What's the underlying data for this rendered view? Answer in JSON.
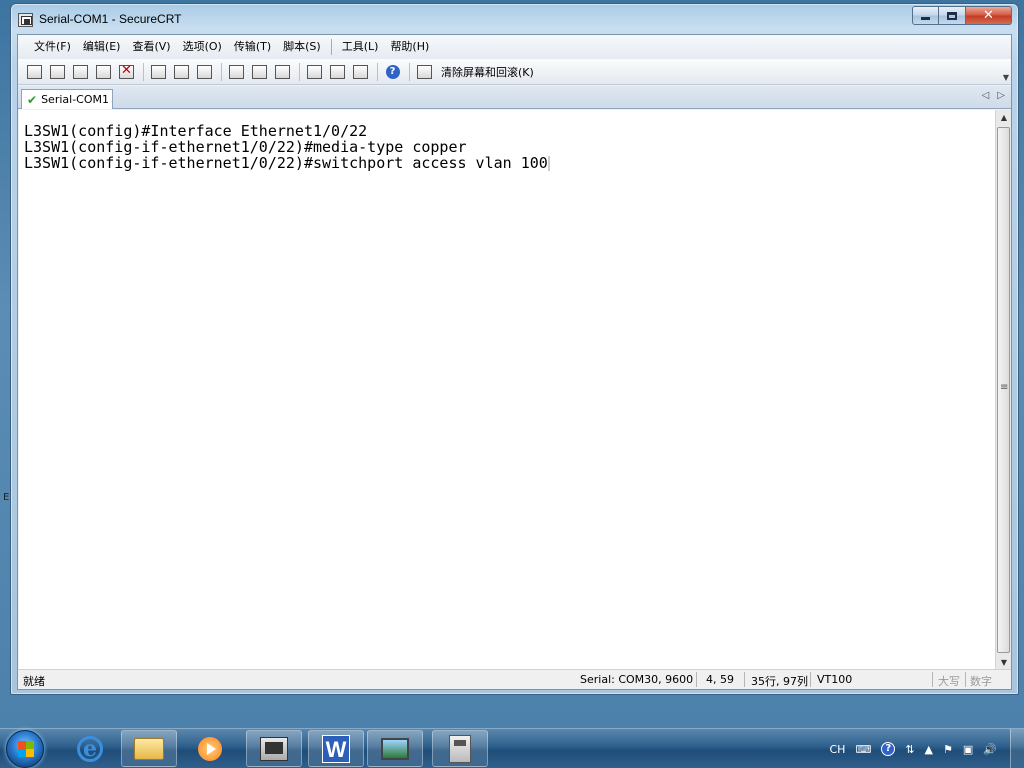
{
  "window": {
    "title": "Serial-COM1 - SecureCRT"
  },
  "menu": [
    "文件(F)",
    "编辑(E)",
    "查看(V)",
    "选项(O)",
    "传输(T)",
    "脚本(S)",
    "工具(L)",
    "帮助(H)"
  ],
  "toolbar": {
    "clear_label": "清除屏幕和回滚(K)",
    "icons": [
      "connect-icon",
      "quick-connect-icon",
      "connect-tab-icon",
      "reconnect-icon",
      "disconnect-icon",
      "copy-icon",
      "paste-icon",
      "find-icon",
      "print-icon",
      "print-selection-icon",
      "print-setup-icon",
      "session-options-icon",
      "global-options-icon",
      "keymap-icon",
      "help-icon",
      "clear-screen-icon"
    ]
  },
  "tab": {
    "label": "Serial-COM1"
  },
  "terminal": {
    "lines": [
      "L3SW1(config)#Interface Ethernet1/0/22",
      "L3SW1(config-if-ethernet1/0/22)#media-type copper",
      "L3SW1(config-if-ethernet1/0/22)#switchport access vlan 100"
    ]
  },
  "status": {
    "ready": "就绪",
    "connection": "Serial: COM30, 9600",
    "cursor_pos": "4,  59",
    "rows_cols": "35行, 97列",
    "emulation": "VT100",
    "caps": "大写",
    "numlock": "数字"
  },
  "tray": {
    "lang": "CH"
  },
  "side_text": "E"
}
